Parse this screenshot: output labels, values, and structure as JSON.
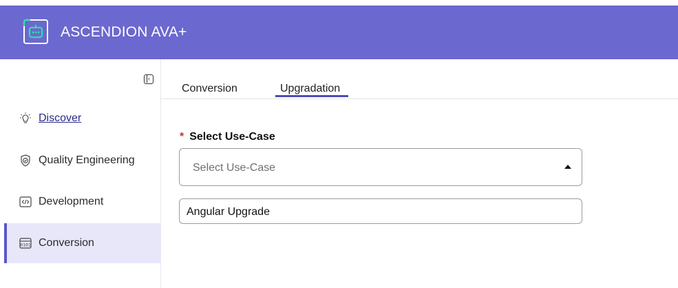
{
  "app": {
    "title": "ASCENDION AVA+"
  },
  "colors": {
    "header_bg": "#6b68cf",
    "accent": "#4e4bb8",
    "active_bg": "#e8e7fa",
    "logo_green": "#2fe0a5"
  },
  "sidebar": {
    "collapse_icon": "sidebar-collapse-icon",
    "items": [
      {
        "label": "Discover",
        "icon": "lightbulb-icon",
        "active": false
      },
      {
        "label": "Quality Engineering",
        "icon": "shield-check-icon",
        "active": false
      },
      {
        "label": "Development",
        "icon": "code-icon",
        "active": false
      },
      {
        "label": "Conversion",
        "icon": "binary-icon",
        "active": true
      }
    ]
  },
  "tabs": [
    {
      "label": "Conversion",
      "active": false
    },
    {
      "label": "Upgradation",
      "active": true
    }
  ],
  "form": {
    "required_mark": "*",
    "label": "Select Use-Case",
    "select_placeholder": "Select Use-Case",
    "options": [
      "Angular Upgrade"
    ]
  }
}
